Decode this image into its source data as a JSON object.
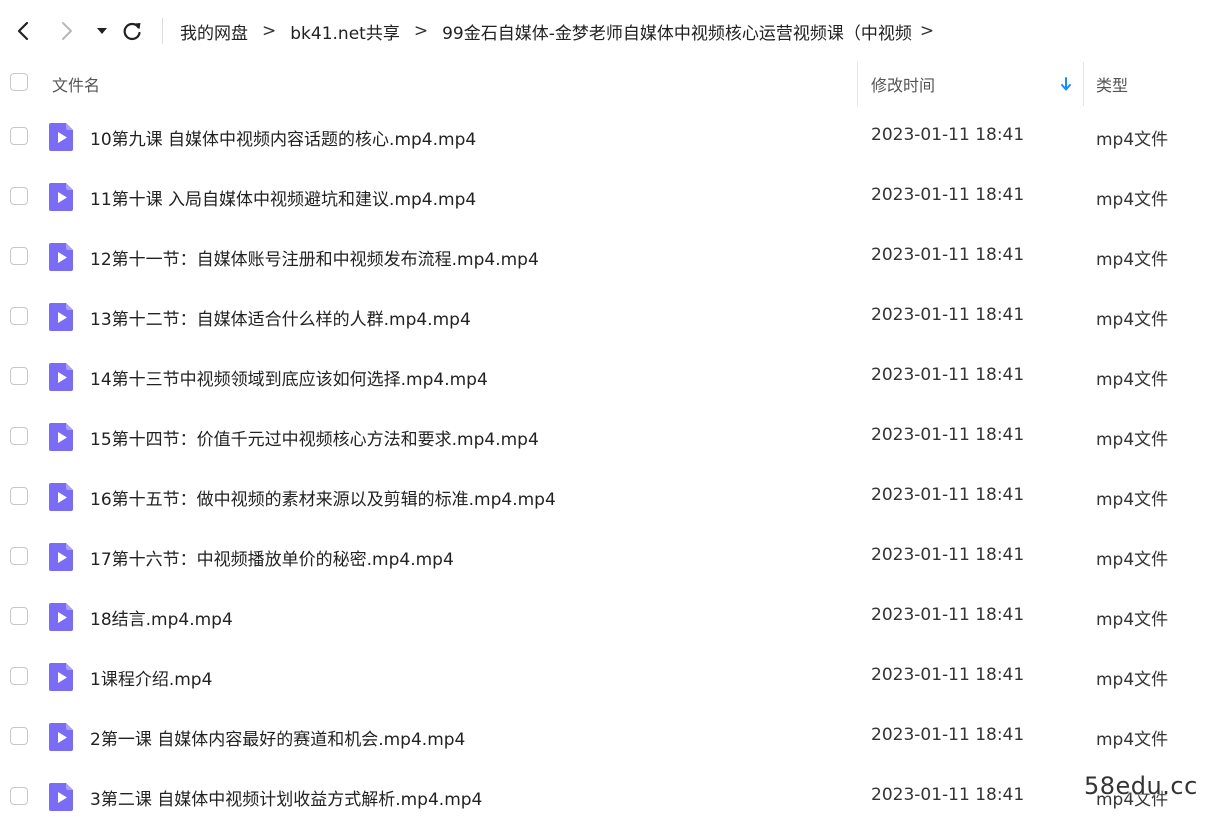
{
  "toolbar": {
    "back_icon": "chevron-left-icon",
    "forward_icon": "chevron-right-icon",
    "dropdown_icon": "caret-down-icon",
    "refresh_icon": "refresh-icon"
  },
  "breadcrumb": {
    "items": [
      "我的网盘",
      "bk41.net共享",
      "99金石自媒体-金梦老师自媒体中视频核心运营视频课（中视频"
    ],
    "separator": ">"
  },
  "table": {
    "headers": {
      "name": "文件名",
      "modified": "修改时间",
      "type": "类型"
    },
    "sort_icon": "arrow-down-icon",
    "sort_color": "#1a8cff",
    "file_icon": "video-file-icon",
    "file_icon_color": "#7b6cf6",
    "rows": [
      {
        "name": "10第九课 自媒体中视频内容话题的核心.mp4.mp4",
        "modified": "2023-01-11 18:41",
        "type": "mp4文件"
      },
      {
        "name": "11第十课 入局自媒体中视频避坑和建议.mp4.mp4",
        "modified": "2023-01-11 18:41",
        "type": "mp4文件"
      },
      {
        "name": "12第十一节：自媒体账号注册和中视频发布流程.mp4.mp4",
        "modified": "2023-01-11 18:41",
        "type": "mp4文件"
      },
      {
        "name": "13第十二节：自媒体适合什么样的人群.mp4.mp4",
        "modified": "2023-01-11 18:41",
        "type": "mp4文件"
      },
      {
        "name": "14第十三节中视频领域到底应该如何选择.mp4.mp4",
        "modified": "2023-01-11 18:41",
        "type": "mp4文件"
      },
      {
        "name": "15第十四节：价值千元过中视频核心方法和要求.mp4.mp4",
        "modified": "2023-01-11 18:41",
        "type": "mp4文件"
      },
      {
        "name": "16第十五节：做中视频的素材来源以及剪辑的标准.mp4.mp4",
        "modified": "2023-01-11 18:41",
        "type": "mp4文件"
      },
      {
        "name": "17第十六节：中视频播放单价的秘密.mp4.mp4",
        "modified": "2023-01-11 18:41",
        "type": "mp4文件"
      },
      {
        "name": "18结言.mp4.mp4",
        "modified": "2023-01-11 18:41",
        "type": "mp4文件"
      },
      {
        "name": "1课程介绍.mp4",
        "modified": "2023-01-11 18:41",
        "type": "mp4文件"
      },
      {
        "name": "2第一课 自媒体内容最好的赛道和机会.mp4.mp4",
        "modified": "2023-01-11 18:41",
        "type": "mp4文件"
      },
      {
        "name": "3第二课 自媒体中视频计划收益方式解析.mp4.mp4",
        "modified": "2023-01-11 18:41",
        "type": "mp4文件"
      }
    ]
  },
  "watermark": "58edu.cc"
}
